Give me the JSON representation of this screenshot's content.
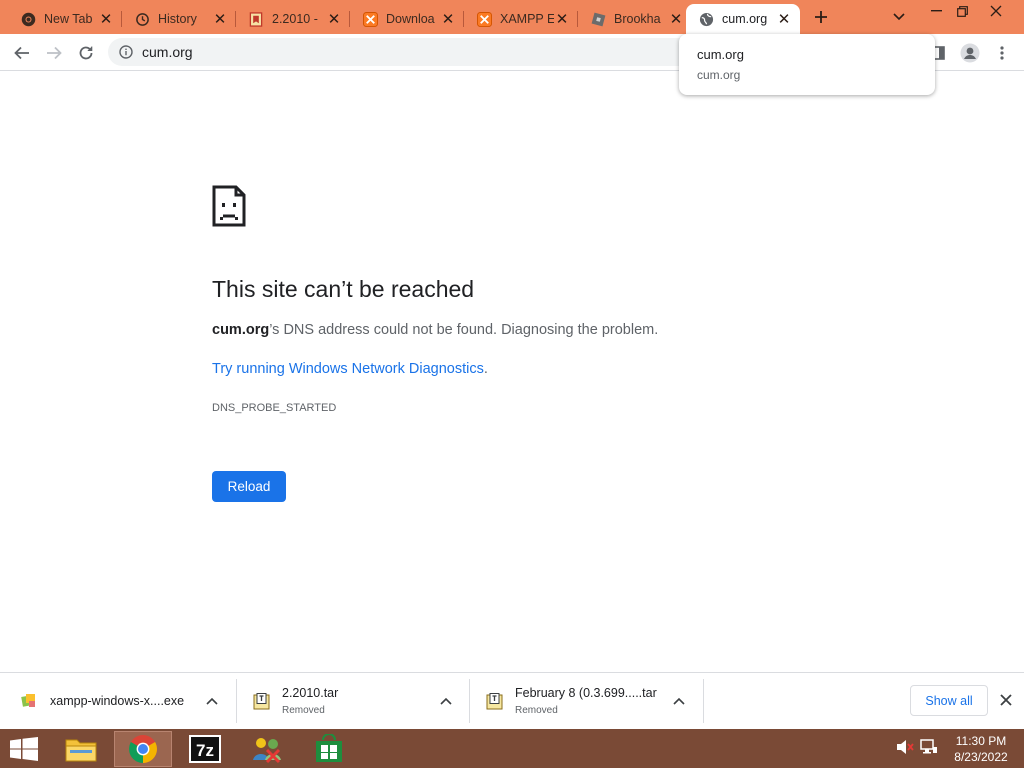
{
  "tabs": [
    {
      "title": "New Tab",
      "icon": "chrome-icon",
      "active": false
    },
    {
      "title": "History",
      "icon": "history-icon",
      "active": false
    },
    {
      "title": "2.2010 -",
      "icon": "bookmark-icon",
      "active": false
    },
    {
      "title": "Downloa",
      "icon": "xampp-icon",
      "active": false
    },
    {
      "title": "XAMPP E",
      "icon": "xampp-icon",
      "active": false
    },
    {
      "title": "Brookha",
      "icon": "generic-site-icon",
      "active": false
    },
    {
      "title": "cum.org",
      "icon": "globe-icon",
      "active": true
    }
  ],
  "omnibox": {
    "url": "cum.org"
  },
  "hovercard": {
    "title": "cum.org",
    "domain": "cum.org"
  },
  "error_page": {
    "title": "This site can’t be reached",
    "host": "cum.org",
    "description_suffix": "’s DNS address could not be found. Diagnosing the problem.",
    "link_text": "Try running Windows Network Diagnostics",
    "link_suffix": ".",
    "error_code": "DNS_PROBE_STARTED",
    "reload_label": "Reload"
  },
  "downloads": [
    {
      "name": "xampp-windows-x....exe",
      "status": "",
      "icon": "xampp-installer-icon"
    },
    {
      "name": "2.2010.tar",
      "status": "Removed",
      "icon": "archive-icon"
    },
    {
      "name": "February 8 (0.3.699.....tar",
      "status": "Removed",
      "icon": "archive-icon"
    }
  ],
  "downloads_bar": {
    "show_all_label": "Show all"
  },
  "taskbar": {
    "apps": [
      "file-explorer-icon",
      "chrome-icon",
      "7zip-icon",
      "network-app-icon",
      "store-icon"
    ],
    "seven_zip_label": "7z",
    "time": "11:30 PM",
    "date": "8/23/2022"
  },
  "colors": {
    "tabstrip": "#f0855a",
    "accent_blue": "#1a73e8",
    "taskbar": "#7a4a36"
  }
}
